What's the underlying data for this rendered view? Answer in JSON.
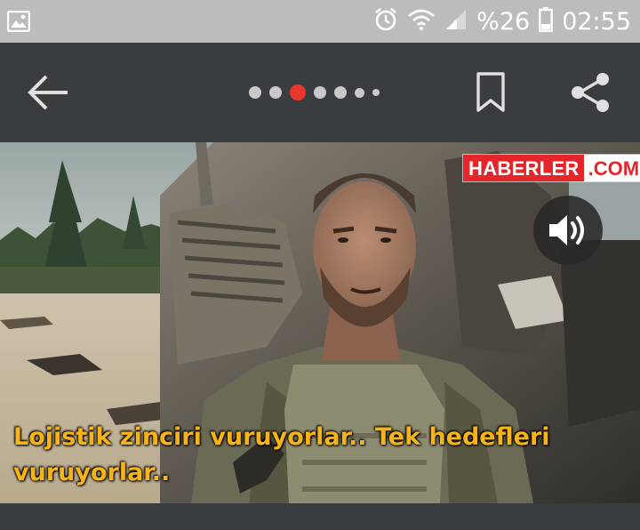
{
  "status_bar": {
    "battery_percent": "%26",
    "time": "02:55",
    "icons": [
      "gallery-icon",
      "alarm-icon",
      "wifi-icon",
      "signal-icon",
      "battery-icon"
    ]
  },
  "toolbar": {
    "icons": [
      "back-arrow-icon",
      "bookmark-icon",
      "share-icon"
    ],
    "pager": {
      "count": 7,
      "active_index": 2,
      "active_color": "#e8362d",
      "inactive_color": "#c9c9c9"
    }
  },
  "video": {
    "watermark": {
      "part1": "HABERLER",
      "part2": ".COM"
    },
    "sound_icon": "volume-icon",
    "subtitle_line1": "Lojistik zinciri vuruyorlar.. Tek hedefleri",
    "subtitle_line2": "vuruyorlar.."
  },
  "colors": {
    "app_bar": "#3a3d40",
    "status_bar": "#bcbcbc",
    "brand_red": "#e3262a",
    "subtitle": "#f7b418"
  }
}
